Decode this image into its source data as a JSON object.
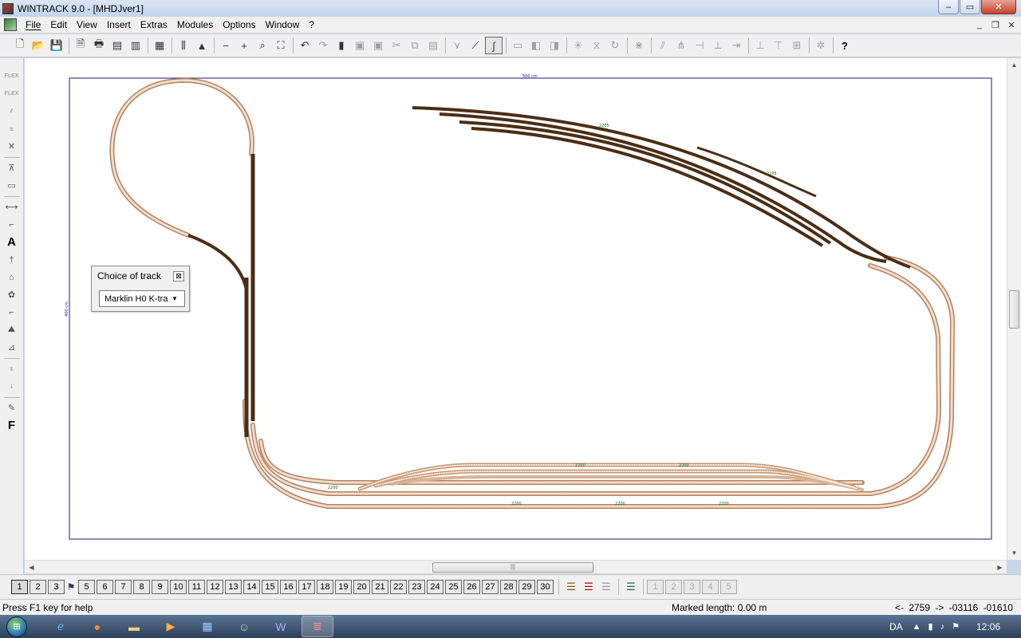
{
  "window": {
    "title": "WINTRACK 9.0 - [MHDJver1]",
    "minimize": "–",
    "maximize": "▭",
    "close": "✕"
  },
  "mdi": {
    "minimize": "_",
    "restore": "❐",
    "close": "✕"
  },
  "menu": {
    "file": "File",
    "edit": "Edit",
    "view": "View",
    "insert": "Insert",
    "extras": "Extras",
    "modules": "Modules",
    "options": "Options",
    "window": "Window",
    "help": "?"
  },
  "toolbar_glyphs": {
    "new": "🗋",
    "open": "📂",
    "save": "💾",
    "preview": "🗎",
    "print": "🖶",
    "undo": "↶",
    "redo": "↷",
    "zoom_out": "−",
    "zoom_in": "+",
    "zoom_fit": "⌕",
    "zoom_all": "⛶",
    "help": "?"
  },
  "plan": {
    "width_label": "500 cm",
    "height_label": "400 cm",
    "track_color": "#6b4423",
    "frame_color": "#1a1a7a",
    "track_number": "2200",
    "dark_track_number": "2205"
  },
  "choice_of_track": {
    "title": "Choice of track",
    "close": "⊠",
    "selected": "Marklin H0 K-tra",
    "dropdown": "▼"
  },
  "scroll": {
    "up": "▲",
    "down": "▼",
    "left": "◀",
    "right": "▶",
    "grip": "|||"
  },
  "layers": {
    "n1": "1",
    "n2": "2",
    "n3": "3",
    "n5": "5",
    "n6": "6",
    "n7": "7",
    "n8": "8",
    "n9": "9",
    "n10": "10",
    "n11": "11",
    "n12": "12",
    "n13": "13",
    "n14": "14",
    "n15": "15",
    "n16": "16",
    "n17": "17",
    "n18": "18",
    "n19": "19",
    "n20": "20",
    "n21": "21",
    "n22": "22",
    "n23": "23",
    "n24": "24",
    "n25": "25",
    "n26": "26",
    "n27": "27",
    "n28": "28",
    "n29": "29",
    "n30": "30",
    "g1": "1",
    "g2": "2",
    "g3": "3",
    "g4": "4",
    "g5": "5",
    "flag": "⚑"
  },
  "status": {
    "help": "Press F1 key for help",
    "marked_length": "Marked length: 0.00 m",
    "scroll_indicator": "<- 2759 ->",
    "x": "-03116",
    "y": "-01610"
  },
  "taskbar": {
    "start": "⊞",
    "language": "DA",
    "clock": "12:06",
    "tray_up": "▲",
    "tray_volume": "♪",
    "tray_net": "▮",
    "tray_flag": "⚑"
  }
}
